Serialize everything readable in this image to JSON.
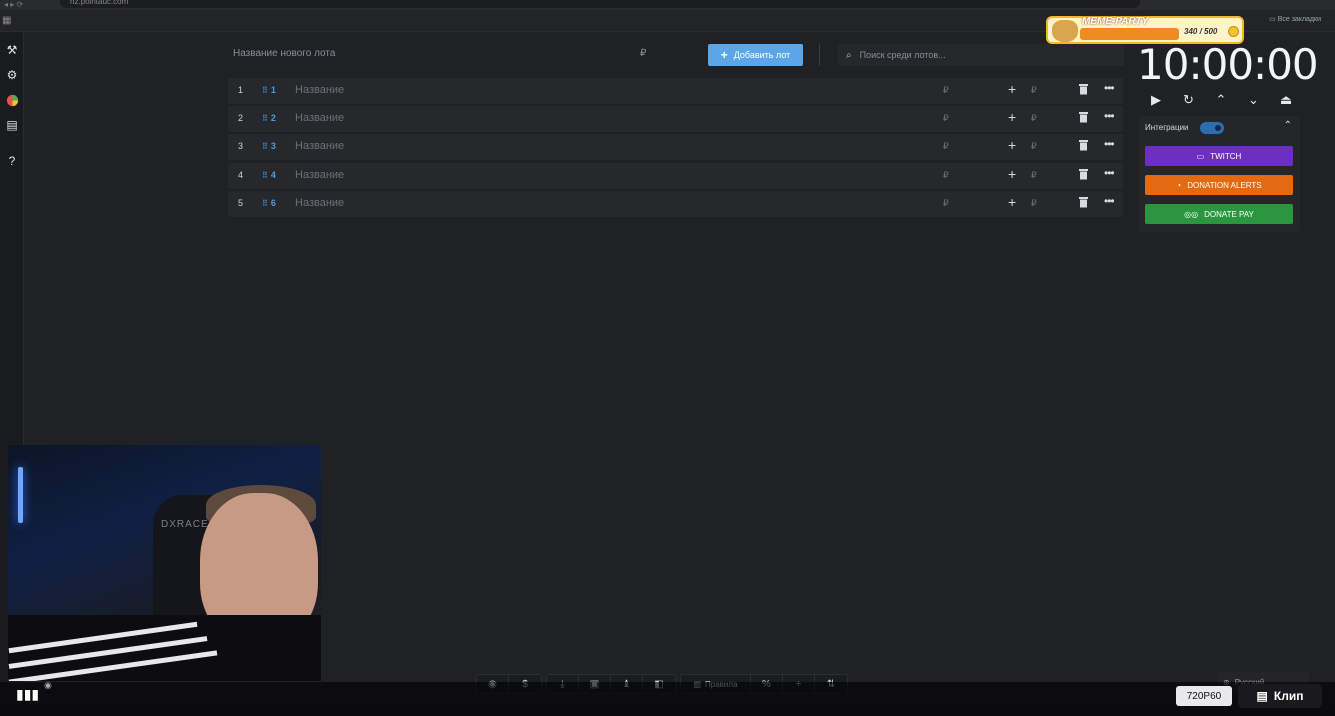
{
  "browser": {
    "url": "nz.pointauc.com",
    "bookmarks_right": "Все закладки"
  },
  "form": {
    "new_lot_placeholder": "Название нового лота",
    "currency": "₽",
    "add_button": "Добавить лот",
    "search_placeholder": "Поиск среди лотов..."
  },
  "lots": [
    {
      "num": "1",
      "tag": "1",
      "name": "Название",
      "cur": "₽"
    },
    {
      "num": "2",
      "tag": "2",
      "name": "Название",
      "cur": "₽"
    },
    {
      "num": "3",
      "tag": "3",
      "name": "Название",
      "cur": "₽"
    },
    {
      "num": "4",
      "tag": "4",
      "name": "Название",
      "cur": "₽"
    },
    {
      "num": "5",
      "tag": "6",
      "name": "Название",
      "cur": "₽"
    }
  ],
  "timer": {
    "value": "10:00:00"
  },
  "integrations": {
    "title": "Интеграции",
    "twitch": "TWITCH",
    "donation_alerts": "DONATION ALERTS",
    "donate_pay": "DONATE PAY"
  },
  "overlay": {
    "meme_label": "MEME-PARTY",
    "meme_count": "340 / 500",
    "meme_progress": 0.68
  },
  "webcam": {
    "chair_text": "DXRACER"
  },
  "bottom": {
    "rules_label": "Правила",
    "language": "Русский"
  },
  "stream": {
    "quality": "720P60",
    "clip_label": "Клип"
  }
}
